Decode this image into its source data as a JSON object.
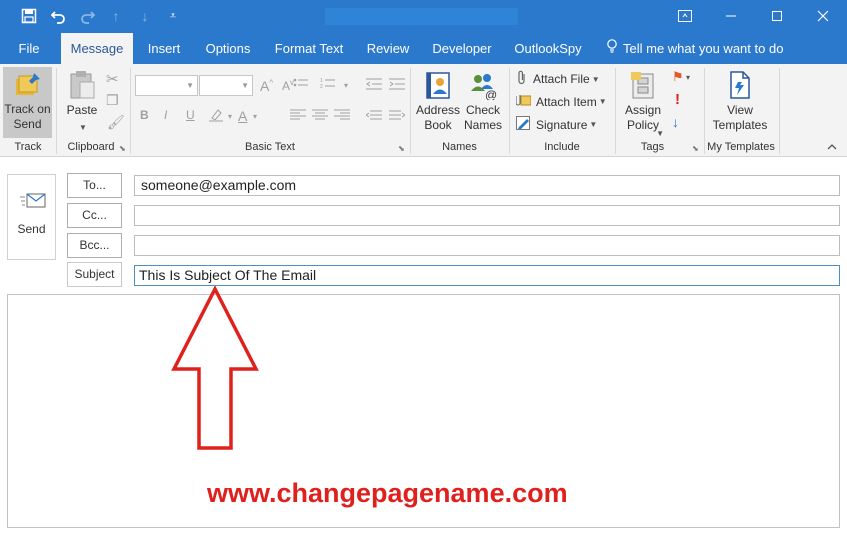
{
  "colors": {
    "titlebar": "#2b79cc",
    "ribbon": "#f3f3f3",
    "accent_text": "#2b579a",
    "annotation": "#e0201d"
  },
  "quick_access": {
    "icons": [
      "save-icon",
      "undo-icon",
      "redo-icon",
      "up-arrow-icon",
      "down-arrow-icon",
      "customize-qat-icon"
    ]
  },
  "window_controls": {
    "icons": [
      "ribbon-display-options-icon",
      "minimize-icon",
      "maximize-icon",
      "close-icon"
    ]
  },
  "tabs": [
    {
      "label": "File"
    },
    {
      "label": "Message"
    },
    {
      "label": "Insert"
    },
    {
      "label": "Options"
    },
    {
      "label": "Format Text"
    },
    {
      "label": "Review"
    },
    {
      "label": "Developer"
    },
    {
      "label": "OutlookSpy"
    }
  ],
  "tell_me": "Tell me what you want to do",
  "ribbon": {
    "track": {
      "button": "Track on Send",
      "label": "Track"
    },
    "clipboard": {
      "paste": "Paste",
      "label": "Clipboard"
    },
    "basic_text": {
      "label": "Basic Text",
      "buttons": [
        "B",
        "I",
        "U"
      ]
    },
    "names": {
      "address_book": "Address Book",
      "check_names": "Check Names",
      "label": "Names"
    },
    "include": {
      "attach_file": "Attach File",
      "attach_item": "Attach Item",
      "signature": "Signature",
      "label": "Include"
    },
    "tags": {
      "assign_policy": "Assign Policy",
      "label": "Tags"
    },
    "templates": {
      "view_templates": "View Templates",
      "label": "My Templates"
    }
  },
  "compose": {
    "send": "Send",
    "to_button": "To...",
    "cc_button": "Cc...",
    "bcc_button": "Bcc...",
    "subject_label": "Subject",
    "to_value": "someone@example.com",
    "cc_value": "",
    "bcc_value": "",
    "subject_value": "This Is Subject Of The Email"
  },
  "annotation": {
    "watermark": "www.changepagename.com"
  }
}
